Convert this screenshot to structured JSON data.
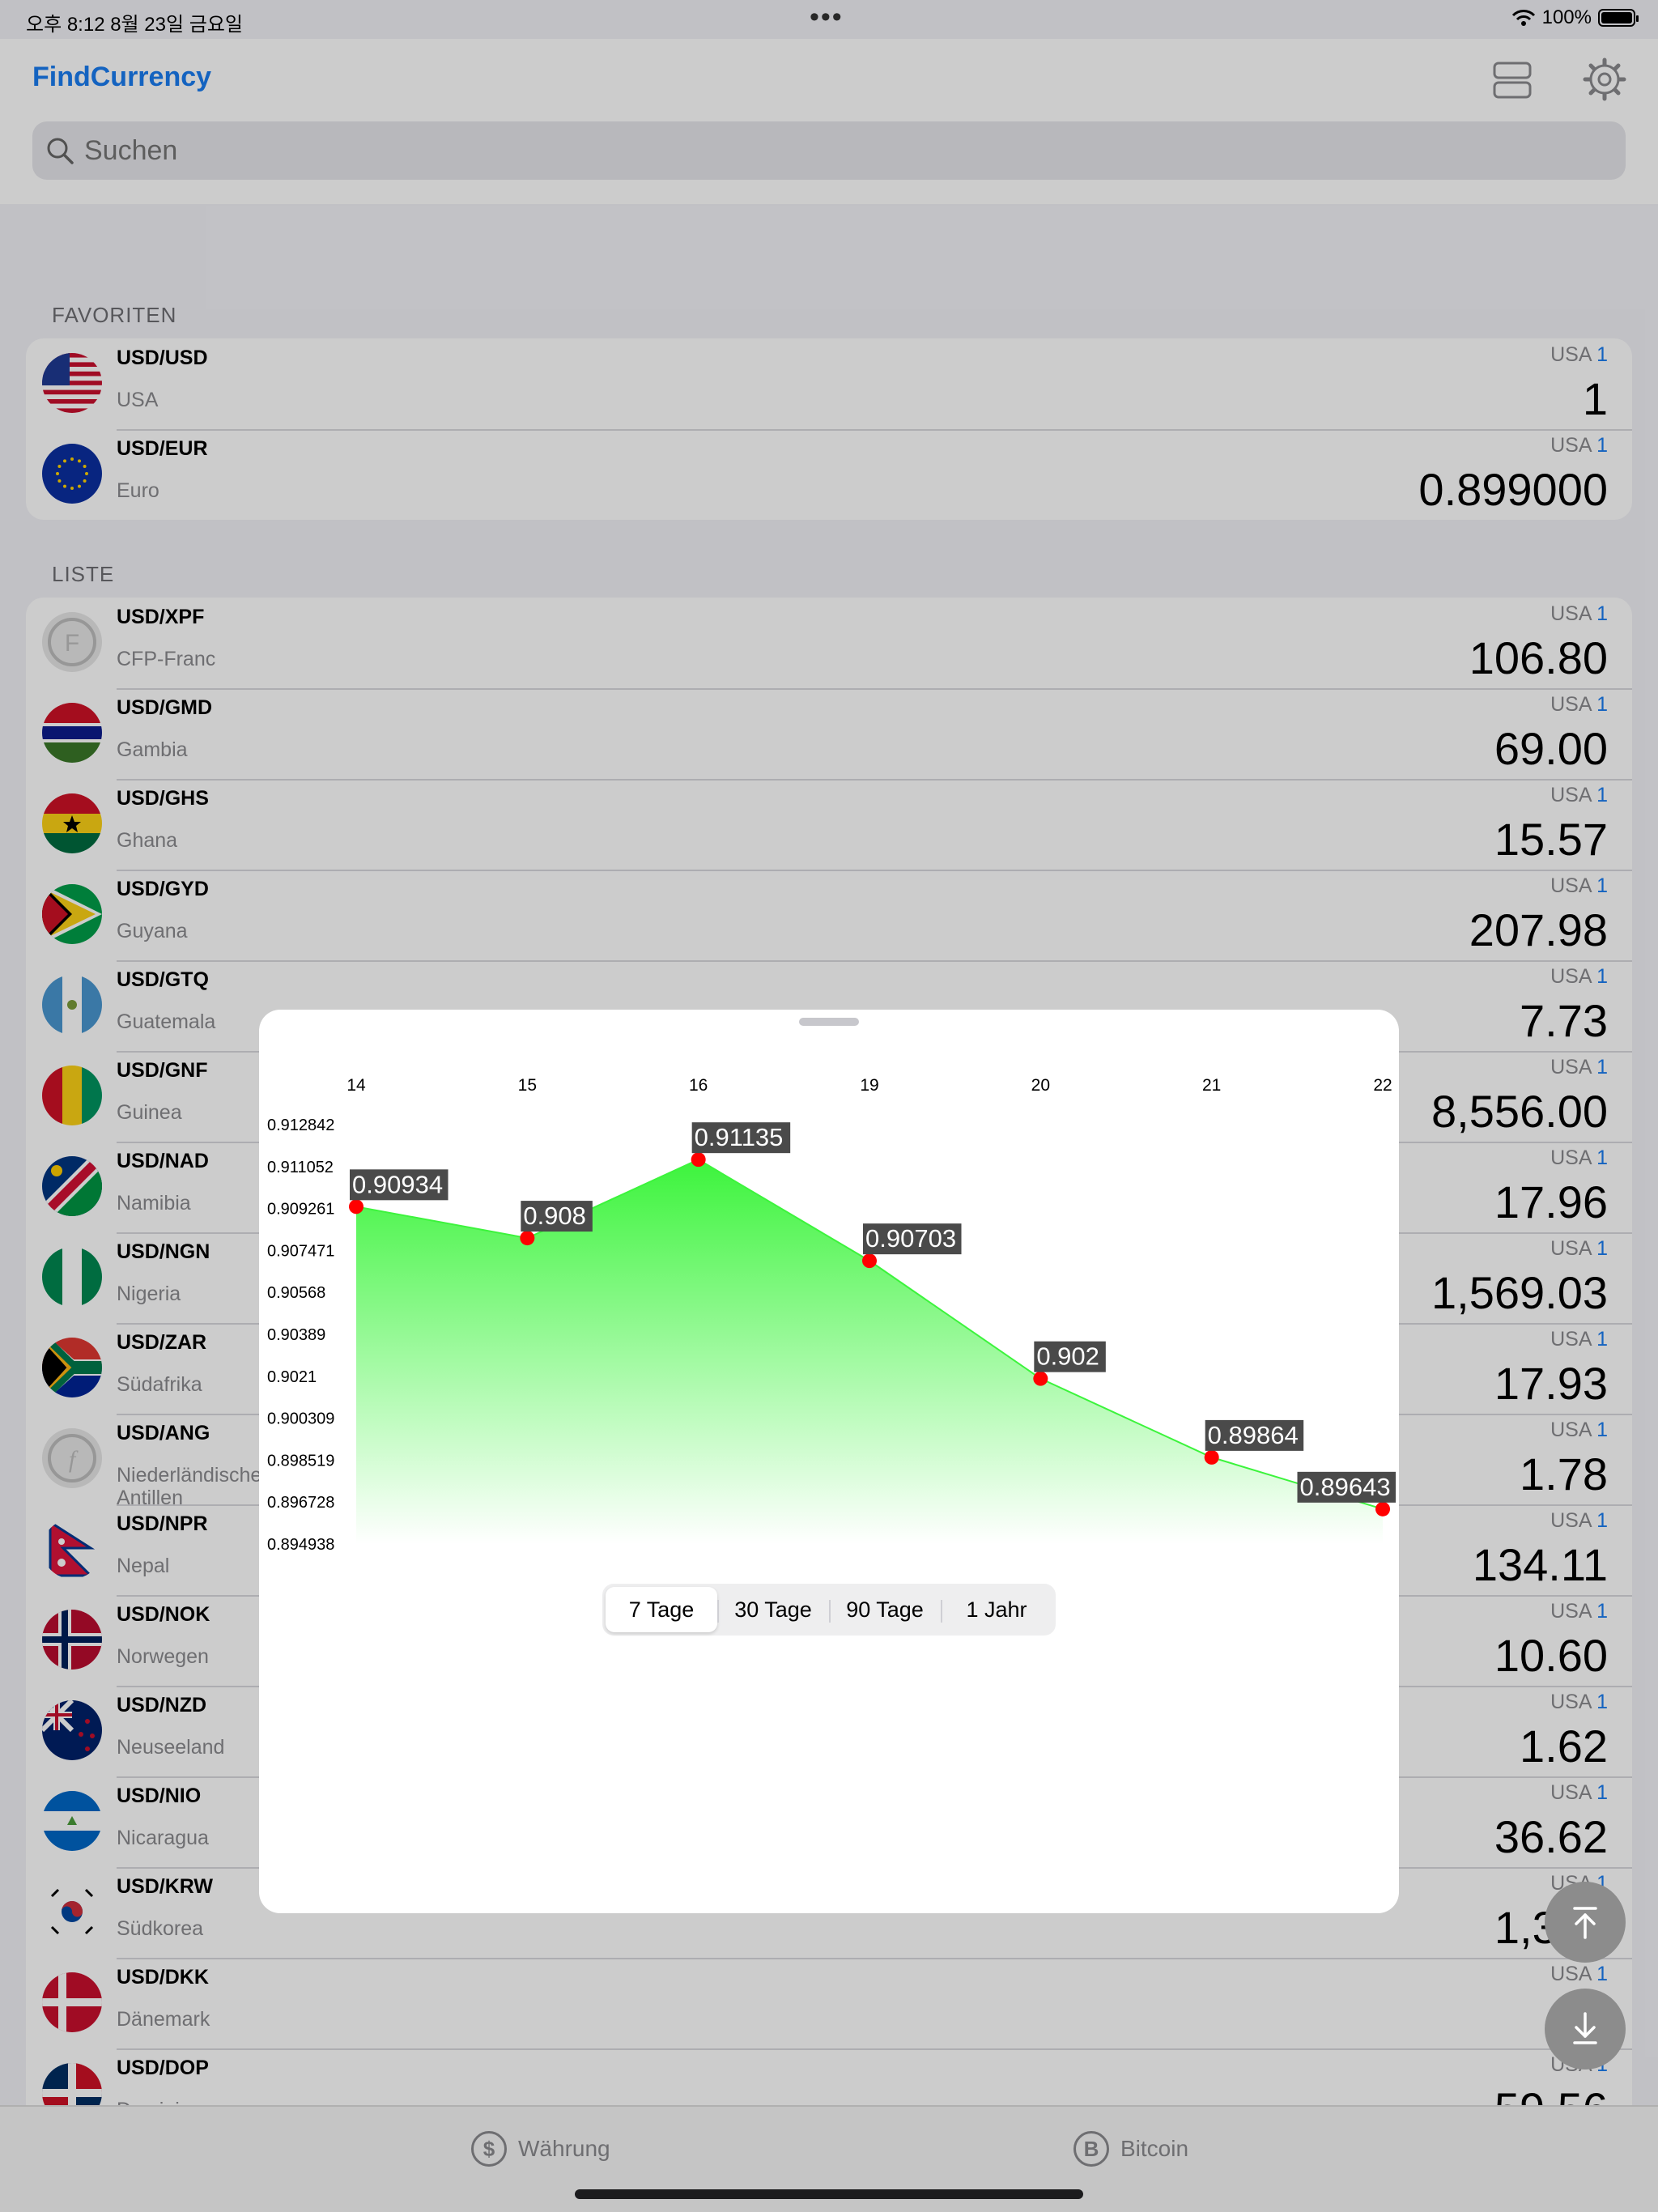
{
  "status": {
    "time": "오후 8:12   8월 23일 금요일",
    "battery": "100%"
  },
  "header": {
    "title": "FindCurrency",
    "search_placeholder": "Suchen"
  },
  "sections": {
    "favorites": "FAVORITEN",
    "list": "LISTE"
  },
  "favorites": [
    {
      "code": "USD/USD",
      "name": "USA",
      "base": "USA",
      "base_amount": "1",
      "value": "1",
      "flag": "us"
    },
    {
      "code": "USD/EUR",
      "name": "Euro",
      "base": "USA",
      "base_amount": "1",
      "value": "0.899000",
      "flag": "eu"
    }
  ],
  "list": [
    {
      "code": "USD/XPF",
      "name": "CFP-Franc",
      "base": "USA",
      "base_amount": "1",
      "value": "106.80",
      "flag": "xpf"
    },
    {
      "code": "USD/GMD",
      "name": "Gambia",
      "base": "USA",
      "base_amount": "1",
      "value": "69.00",
      "flag": "gm"
    },
    {
      "code": "USD/GHS",
      "name": "Ghana",
      "base": "USA",
      "base_amount": "1",
      "value": "15.57",
      "flag": "gh"
    },
    {
      "code": "USD/GYD",
      "name": "Guyana",
      "base": "USA",
      "base_amount": "1",
      "value": "207.98",
      "flag": "gy"
    },
    {
      "code": "USD/GTQ",
      "name": "Guatemala",
      "base": "USA",
      "base_amount": "1",
      "value": "7.73",
      "flag": "gt"
    },
    {
      "code": "USD/GNF",
      "name": "Guinea",
      "base": "USA",
      "base_amount": "1",
      "value": "8,556.00",
      "flag": "gn"
    },
    {
      "code": "USD/NAD",
      "name": "Namibia",
      "base": "USA",
      "base_amount": "1",
      "value": "17.96",
      "flag": "na"
    },
    {
      "code": "USD/NGN",
      "name": "Nigeria",
      "base": "USA",
      "base_amount": "1",
      "value": "1,569.03",
      "flag": "ng"
    },
    {
      "code": "USD/ZAR",
      "name": "Südafrika",
      "base": "USA",
      "base_amount": "1",
      "value": "17.93",
      "flag": "za"
    },
    {
      "code": "USD/ANG",
      "name": "Niederländische Antillen",
      "base": "USA",
      "base_amount": "1",
      "value": "1.78",
      "flag": "ang"
    },
    {
      "code": "USD/NPR",
      "name": "Nepal",
      "base": "USA",
      "base_amount": "1",
      "value": "134.11",
      "flag": "np"
    },
    {
      "code": "USD/NOK",
      "name": "Norwegen",
      "base": "USA",
      "base_amount": "1",
      "value": "10.60",
      "flag": "no"
    },
    {
      "code": "USD/NZD",
      "name": "Neuseeland",
      "base": "USA",
      "base_amount": "1",
      "value": "1.62",
      "flag": "nz"
    },
    {
      "code": "USD/NIO",
      "name": "Nicaragua",
      "base": "USA",
      "base_amount": "1",
      "value": "36.62",
      "flag": "ni"
    },
    {
      "code": "USD/KRW",
      "name": "Südkorea",
      "base": "USA",
      "base_amount": "1",
      "value": "1,337",
      "flag": "kr"
    },
    {
      "code": "USD/DKK",
      "name": "Dänemark",
      "base": "USA",
      "base_amount": "1",
      "value": "6",
      "flag": "dk"
    },
    {
      "code": "USD/DOP",
      "name": "Dominica",
      "base": "USA",
      "base_amount": "1",
      "value": "59.56",
      "flag": "do"
    }
  ],
  "chart_data": {
    "type": "area",
    "x": [
      "14",
      "15",
      "16",
      "19",
      "20",
      "21",
      "22"
    ],
    "values": [
      0.90934,
      0.908,
      0.91135,
      0.90703,
      0.902,
      0.89864,
      0.89643
    ],
    "value_labels": [
      "0.90934",
      "0.908",
      "0.91135",
      "0.90703",
      "0.902",
      "0.89864",
      "0.89643"
    ],
    "y_ticks": [
      "0.912842",
      "0.911052",
      "0.909261",
      "0.907471",
      "0.90568",
      "0.90389",
      "0.9021",
      "0.900309",
      "0.898519",
      "0.896728",
      "0.894938"
    ],
    "ylim": [
      0.894938,
      0.912842
    ],
    "fill_color": "#3cf43c",
    "point_color": "#ff0000"
  },
  "range_options": [
    "7 Tage",
    "30 Tage",
    "90 Tage",
    "1 Jahr"
  ],
  "selected_range": "7 Tage",
  "tabs": [
    {
      "label": "Währung",
      "icon": "dollar-icon"
    },
    {
      "label": "Bitcoin",
      "icon": "bitcoin-icon"
    }
  ]
}
